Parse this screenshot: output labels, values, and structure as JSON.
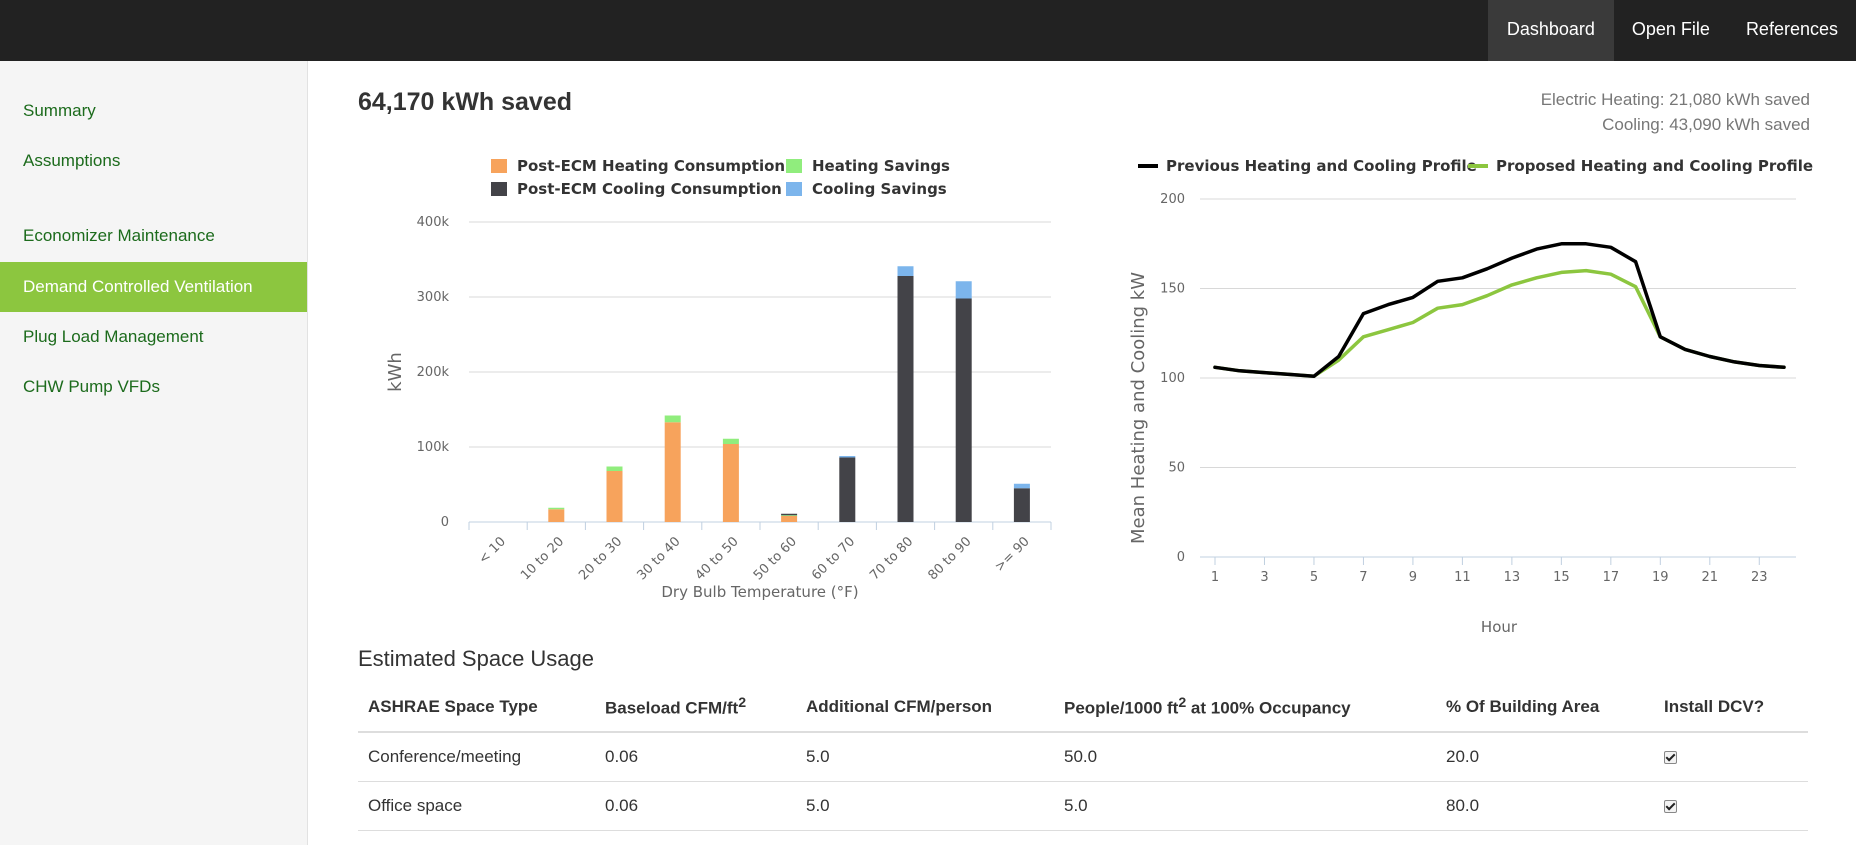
{
  "nav": {
    "items": [
      "Dashboard",
      "Open File",
      "References"
    ],
    "active": "Dashboard"
  },
  "sidebar": {
    "items": [
      {
        "label": "Summary"
      },
      {
        "label": "Assumptions"
      },
      {
        "label": "Economizer Maintenance"
      },
      {
        "label": "Demand Controlled Ventilation",
        "active": true
      },
      {
        "label": "Plug Load Management"
      },
      {
        "label": "CHW Pump VFDs"
      }
    ]
  },
  "summary": {
    "headline": "64,170 kWh saved",
    "electric_heating": "Electric Heating: 21,080 kWh saved",
    "cooling": "Cooling: 43,090 kWh saved"
  },
  "colors": {
    "heating": "#f7a35c",
    "cooling": "#434348",
    "heating_savings": "#90ed7d",
    "cooling_savings": "#7cb5ec",
    "previous": "#000000",
    "proposed": "#8cc63f",
    "accent": "#8cc63f"
  },
  "chart_data": [
    {
      "type": "bar",
      "stacked": true,
      "categories": [
        "< 10",
        "10 to 20",
        "20 to 30",
        "30 to 40",
        "40 to 50",
        "50 to 60",
        "60 to 70",
        "70 to 80",
        "80 to 90",
        ">= 90"
      ],
      "series": [
        {
          "name": "Post-ECM Heating Consumption",
          "values": [
            0,
            17000,
            68000,
            133000,
            104000,
            8000,
            0,
            0,
            0,
            0
          ]
        },
        {
          "name": "Heating Savings",
          "values": [
            0,
            2000,
            6000,
            9000,
            7000,
            1000,
            0,
            0,
            0,
            0
          ]
        },
        {
          "name": "Post-ECM Cooling Consumption",
          "values": [
            0,
            0,
            0,
            0,
            0,
            2000,
            86000,
            328000,
            298000,
            45000
          ]
        },
        {
          "name": "Cooling Savings",
          "values": [
            0,
            0,
            0,
            0,
            0,
            0,
            2000,
            13000,
            23000,
            6000
          ]
        }
      ],
      "xlabel": "Dry Bulb Temperature (°F)",
      "ylabel": "kWh",
      "ylim": [
        0,
        400000
      ],
      "yticks": [
        0,
        100000,
        200000,
        300000,
        400000
      ],
      "ytick_labels": [
        "0",
        "100k",
        "200k",
        "300k",
        "400k"
      ],
      "legend": "top",
      "grid": true
    },
    {
      "type": "line",
      "x": [
        1,
        2,
        3,
        4,
        5,
        6,
        7,
        8,
        9,
        10,
        11,
        12,
        13,
        14,
        15,
        16,
        17,
        18,
        19,
        20,
        21,
        22,
        23,
        24
      ],
      "series": [
        {
          "name": "Previous Heating and Cooling Profile",
          "values": [
            106,
            104,
            103,
            102,
            101,
            112,
            136,
            141,
            145,
            154,
            156,
            161,
            167,
            172,
            175,
            175,
            173,
            165,
            123,
            116,
            112,
            109,
            107,
            106
          ]
        },
        {
          "name": "Proposed Heating and Cooling Profile",
          "values": [
            106,
            104,
            103,
            102,
            101,
            110,
            123,
            127,
            131,
            139,
            141,
            146,
            152,
            156,
            159,
            160,
            158,
            151,
            123,
            116,
            112,
            109,
            107,
            106
          ]
        }
      ],
      "xlabel": "Hour",
      "ylabel": "Mean Heating and Cooling kW",
      "ylim": [
        0,
        200
      ],
      "yticks": [
        0,
        50,
        100,
        150,
        200
      ],
      "xticks": [
        1,
        3,
        5,
        7,
        9,
        11,
        13,
        15,
        17,
        19,
        21,
        23
      ],
      "legend": "top",
      "grid": true
    }
  ],
  "usage": {
    "title": "Estimated Space Usage",
    "headers": {
      "space_type": "ASHRAE Space Type",
      "baseload_prefix": "Baseload CFM/ft",
      "sup2": "2",
      "additional": "Additional CFM/person",
      "people_prefix": "People/1000 ft",
      "people_suffix": " at 100% Occupancy",
      "percent": "% Of Building Area",
      "install": "Install DCV?"
    },
    "rows": [
      {
        "space_type": "Conference/meeting",
        "baseload": "0.06",
        "additional": "5.0",
        "people": "50.0",
        "percent": "20.0",
        "install": true
      },
      {
        "space_type": "Office space",
        "baseload": "0.06",
        "additional": "5.0",
        "people": "5.0",
        "percent": "80.0",
        "install": true
      }
    ]
  }
}
